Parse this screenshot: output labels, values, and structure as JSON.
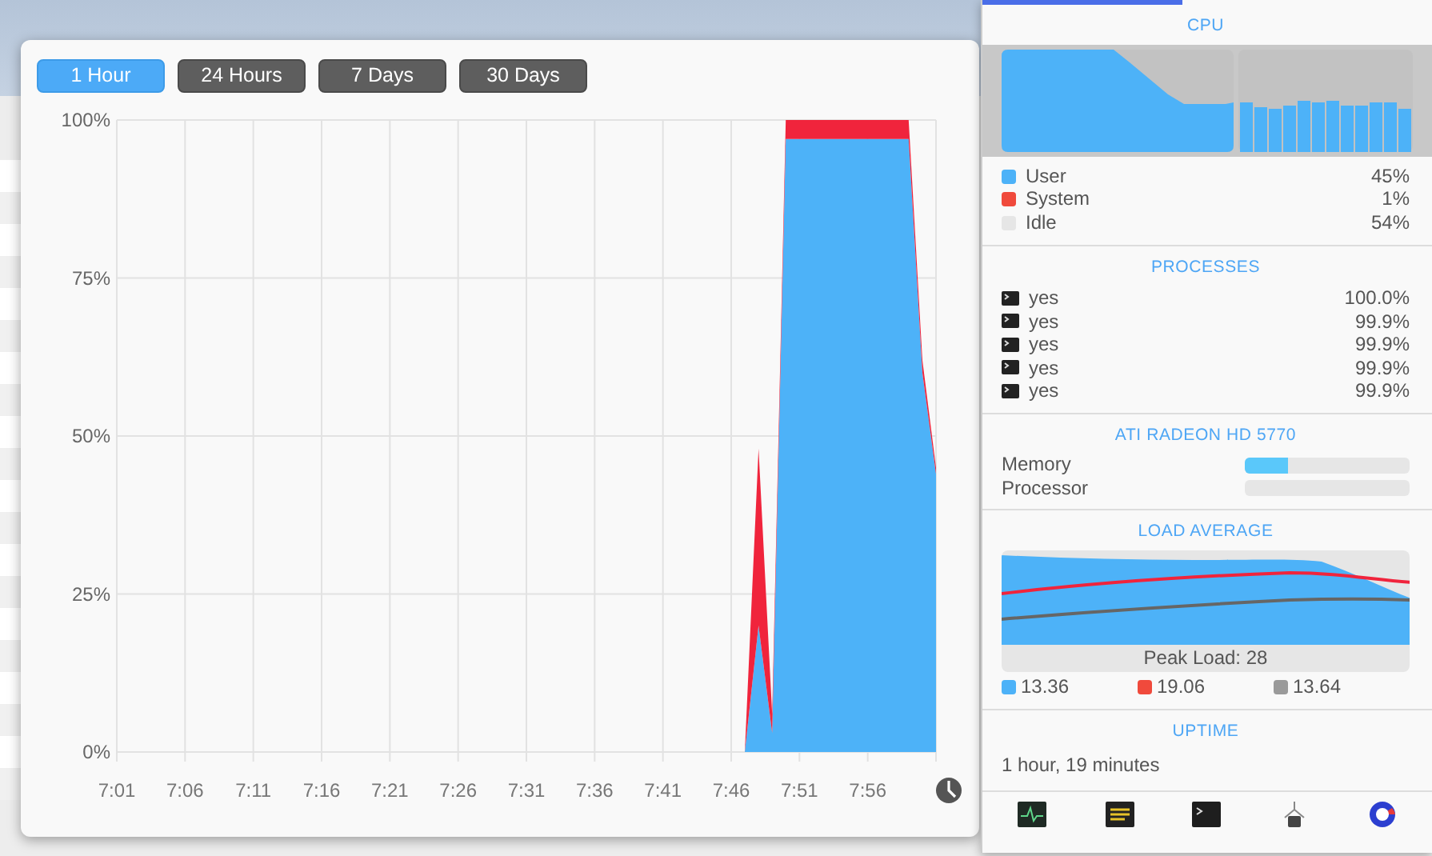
{
  "tabs": [
    {
      "label": "1 Hour",
      "selected": true
    },
    {
      "label": "24 Hours",
      "selected": false
    },
    {
      "label": "7 Days",
      "selected": false
    },
    {
      "label": "30 Days",
      "selected": false
    }
  ],
  "history": {
    "chart_data": {
      "type": "area",
      "stacked": true,
      "grid": true,
      "categories": [
        "7:01",
        null,
        null,
        null,
        null,
        "7:06",
        null,
        null,
        null,
        null,
        "7:11",
        null,
        null,
        null,
        null,
        "7:16",
        null,
        null,
        null,
        null,
        "7:21",
        null,
        null,
        null,
        null,
        "7:26",
        null,
        null,
        null,
        null,
        "7:31",
        null,
        null,
        null,
        null,
        "7:36",
        null,
        null,
        null,
        null,
        "7:41",
        null,
        null,
        null,
        null,
        "7:46",
        null,
        null,
        null,
        null,
        "7:51",
        null,
        null,
        null,
        null,
        "7:56",
        null,
        null,
        null,
        null,
        null
      ],
      "series": [
        {
          "color": "#4db2f8",
          "values": [
            0,
            0,
            0,
            0,
            0,
            0,
            0,
            0,
            0,
            0,
            0,
            0,
            0,
            0,
            0,
            0,
            0,
            0,
            0,
            0,
            0,
            0,
            0,
            0,
            0,
            0,
            0,
            0,
            0,
            0,
            0,
            0,
            0,
            0,
            0,
            0,
            0,
            0,
            0,
            0,
            0,
            0,
            0,
            0,
            0,
            0,
            0,
            0.2,
            0.03,
            0.97,
            0.97,
            0.97,
            0.97,
            0.97,
            0.97,
            0.97,
            0.97,
            0.97,
            0.97,
            0.6,
            0.44
          ]
        },
        {
          "color": "#f0243c",
          "values": [
            0,
            0,
            0,
            0,
            0,
            0,
            0,
            0,
            0,
            0,
            0,
            0,
            0,
            0,
            0,
            0,
            0,
            0,
            0,
            0,
            0,
            0,
            0,
            0,
            0,
            0,
            0,
            0,
            0,
            0,
            0,
            0,
            0,
            0,
            0,
            0,
            0,
            0,
            0,
            0,
            0,
            0,
            0,
            0,
            0,
            0,
            0,
            0.28,
            0.03,
            0.03,
            0.03,
            0.03,
            0.03,
            0.03,
            0.03,
            0.03,
            0.03,
            0.03,
            0.03,
            0.02,
            0.01
          ]
        }
      ],
      "ylim": [
        0,
        1
      ],
      "yticks": [
        {
          "value": 0,
          "label": "0%"
        },
        {
          "value": 0.25,
          "label": "25%"
        },
        {
          "value": 0.5,
          "label": "50%"
        },
        {
          "value": 0.75,
          "label": "75%"
        },
        {
          "value": 1,
          "label": "100%"
        }
      ]
    }
  },
  "sidebar": {
    "cpu": {
      "title": "CPU",
      "legend": [
        {
          "label": "User",
          "value": "45%",
          "color": "#4db2f8"
        },
        {
          "label": "System",
          "value": "1%",
          "color": "#f04a3c"
        },
        {
          "label": "Idle",
          "value": "54%",
          "color": "#e6e6e6"
        }
      ]
    },
    "processes": {
      "title": "PROCESSES",
      "items": [
        {
          "name": "yes",
          "value": "100.0%"
        },
        {
          "name": "yes",
          "value": "99.9%"
        },
        {
          "name": "yes",
          "value": "99.9%"
        },
        {
          "name": "yes",
          "value": "99.9%"
        },
        {
          "name": "yes",
          "value": "99.9%"
        }
      ]
    },
    "gpu": {
      "title": "ATI RADEON HD 5770",
      "meters": [
        {
          "label": "Memory",
          "level": 0.26
        },
        {
          "label": "Processor",
          "level": 0
        }
      ]
    },
    "load_average": {
      "title": "LOAD AVERAGE",
      "peak": "Peak Load: 28",
      "legend": [
        {
          "value": "13.36",
          "color": "#4db2f8"
        },
        {
          "value": "19.06",
          "color": "#f04a3c"
        },
        {
          "value": "13.64",
          "color": "#9a9a9a"
        }
      ]
    },
    "uptime": {
      "title": "UPTIME",
      "value": "1 hour, 19 minutes"
    }
  }
}
